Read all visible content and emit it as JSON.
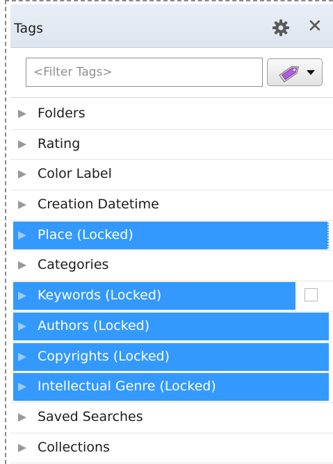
{
  "panel": {
    "title": "Tags",
    "gear_icon": "gear-icon",
    "close_icon": "close-icon",
    "close_glyph": "✕"
  },
  "filter": {
    "placeholder": "<Filter Tags>",
    "value": ""
  },
  "tag_button": {
    "icon": "tag-icon",
    "dropdown_icon": "chevron-down-icon"
  },
  "colors": {
    "selection": "#3399ff",
    "header_bg": "#e3e9f1",
    "arrow": "#999999"
  },
  "tags": [
    {
      "label": "Folders",
      "selected": false
    },
    {
      "label": "Rating",
      "selected": false
    },
    {
      "label": "Color Label",
      "selected": false
    },
    {
      "label": "Creation Datetime",
      "selected": false
    },
    {
      "label": "Place (Locked)",
      "selected": true
    },
    {
      "label": "Categories",
      "selected": false
    },
    {
      "label": "Keywords (Locked)",
      "selected": true,
      "checkbox": true
    },
    {
      "label": "Authors (Locked)",
      "selected": true
    },
    {
      "label": "Copyrights (Locked)",
      "selected": true
    },
    {
      "label": "Intellectual Genre (Locked)",
      "selected": true
    },
    {
      "label": "Saved Searches",
      "selected": false
    },
    {
      "label": "Collections",
      "selected": false
    }
  ]
}
